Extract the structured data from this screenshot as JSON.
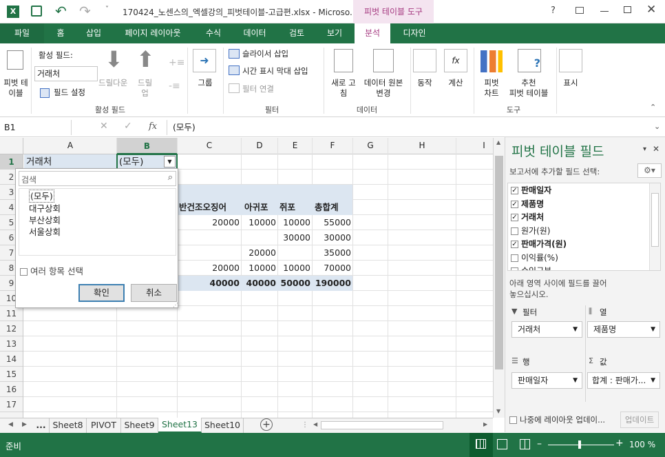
{
  "title": {
    "text": "170424_노센스의_엑셀강의_피벗테이블-고급편.xlsx - Microso...",
    "context_tab": "피벗 테이블 도구",
    "help": "?"
  },
  "tabs": [
    "파일",
    "홈",
    "삽입",
    "페이지 레이아웃",
    "수식",
    "데이터",
    "검토",
    "보기",
    "분석",
    "디자인"
  ],
  "ribbon": {
    "pivot_table": "피벗 테\n이블",
    "active_field_label": "활성 필드:",
    "active_field_value": "거래처",
    "field_settings": "필드 설정",
    "drill_down": "드릴다운",
    "drill_up": "드릴\n업",
    "group": "그룹",
    "insert_slicer": "슬라이서 삽입",
    "insert_timeline": "시간 표시 막대 삽입",
    "filter_connections": "필터 연결",
    "refresh": "새로 고\n침",
    "change_source": "데이터 원본\n변경",
    "actions": "동작",
    "calculations": "계산",
    "pivot_chart": "피벗\n차트",
    "recommended": "추천\n피벗 테이블",
    "show": "표시",
    "groups": [
      "활성 필드",
      "필터",
      "데이터",
      "도구"
    ]
  },
  "formula_bar": {
    "name_box": "B1",
    "fx": "fx",
    "content": "(모두)"
  },
  "columns": [
    "A",
    "B",
    "C",
    "D",
    "E",
    "F",
    "G",
    "H",
    "I"
  ],
  "rows": [
    "1",
    "2",
    "3",
    "4",
    "5",
    "6",
    "7",
    "8",
    "9",
    "10",
    "11",
    "12",
    "13",
    "14",
    "15",
    "16",
    "17"
  ],
  "cells": {
    "a1": "거래처",
    "b1": "(모두)",
    "c4": "반건조오징어",
    "d4": "아귀포",
    "e4": "쥐포",
    "f4": "총합계",
    "c5": "20000",
    "d5": "10000",
    "e5": "10000",
    "f5": "55000",
    "e6": "30000",
    "f6": "30000",
    "d7": "20000",
    "f7": "35000",
    "c8": "20000",
    "d8": "10000",
    "e8": "10000",
    "f8": "70000",
    "c9": "40000",
    "d9": "40000",
    "e9": "50000",
    "f9": "190000"
  },
  "filter_popup": {
    "search_placeholder": "검색",
    "items": [
      "(모두)",
      "대구상회",
      "부산상회",
      "서울상회"
    ],
    "multi_select": "여러 항목 선택",
    "ok": "확인",
    "cancel": "취소"
  },
  "pivot_pane": {
    "title": "피벗 테이블 필드",
    "subtitle": "보고서에 추가할 필드 선택:",
    "fields": [
      {
        "name": "판매일자",
        "checked": true
      },
      {
        "name": "제품명",
        "checked": true
      },
      {
        "name": "거래처",
        "checked": true
      },
      {
        "name": "원가(원)",
        "checked": false
      },
      {
        "name": "판매가격(원)",
        "checked": true
      },
      {
        "name": "이익률(%)",
        "checked": false
      },
      {
        "name": "수익구분",
        "checked": false
      }
    ],
    "drag_hint": "아래 영역 사이에 필드를 끌어\n놓으십시오.",
    "filter_label": "필터",
    "columns_label": "열",
    "rows_label": "행",
    "values_label": "값",
    "filter_value": "거래처",
    "columns_value": "제품명",
    "rows_value": "판매일자",
    "values_value": "합계 : 판매가...",
    "defer": "나중에 레이아웃 업데이...",
    "update": "업데이트"
  },
  "sheet_tabs": [
    "...",
    "Sheet8",
    "PIVOT",
    "Sheet9",
    "Sheet13",
    "Sheet10"
  ],
  "active_sheet": "Sheet13",
  "status": {
    "ready": "준비",
    "zoom": "100 %"
  }
}
